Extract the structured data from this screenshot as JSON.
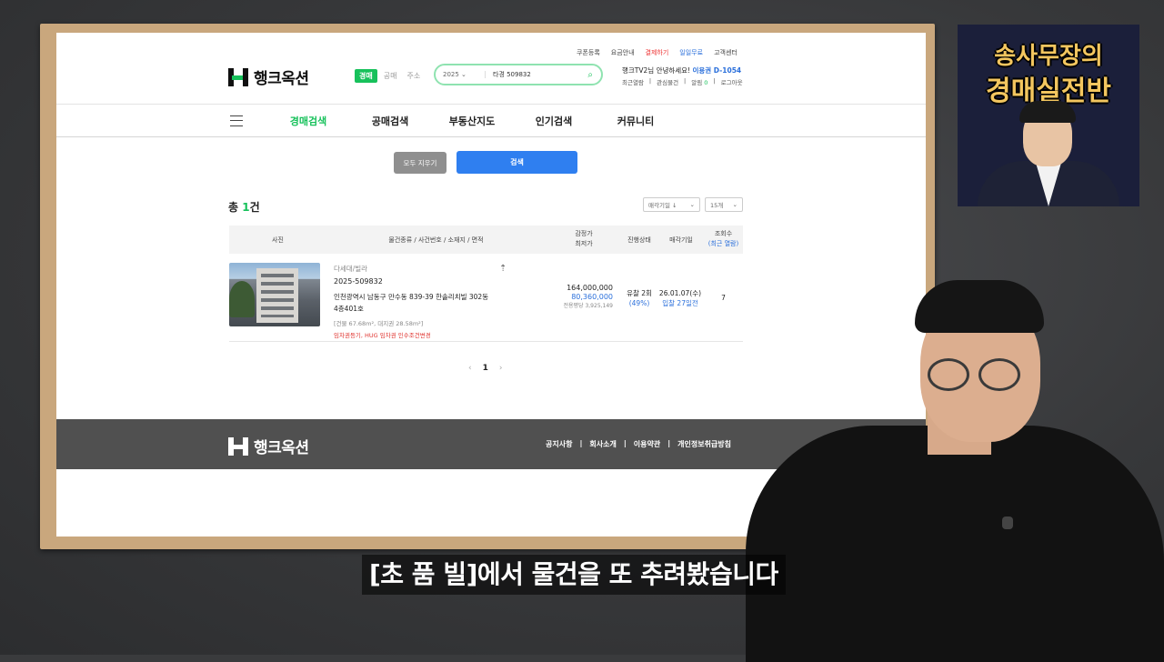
{
  "site": {
    "brand": "행크옥션",
    "top_links": [
      "쿠폰등록",
      "요금안내",
      "결제하기",
      "일일무료",
      "고객센터"
    ],
    "search_tabs": [
      "경매",
      "공매",
      "주소"
    ],
    "search_year": "2025",
    "search_query": "타경 509832",
    "greeting": "행크TV2님 안녕하세요!",
    "plan": "이용권 D-1054",
    "user_links": [
      "최근열람",
      "관심물건",
      "알림",
      "0",
      "로그아웃"
    ],
    "main_menu": [
      "경매검색",
      "공매검색",
      "부동산지도",
      "인기검색",
      "커뮤니티"
    ],
    "clear_button": "모두 지우기",
    "search_button": "검색",
    "total_prefix": "총 ",
    "total_count": "1",
    "total_suffix": "건",
    "sort_select": "매각기일 ↓",
    "page_size_select": "15개",
    "table_headers": {
      "photo": "사진",
      "info": "물건종류 / 사건번호 / 소재지 / 면적",
      "price_1": "감정가",
      "price_2": "최저가",
      "status": "진행상태",
      "date": "매각기일",
      "views_1": "조회수",
      "views_2": "(최근 열람)"
    },
    "listing": {
      "type": "다세대/빌라",
      "case_no": "2025-509832",
      "address_1": "인천광역시 남동구 만수동 839-39 한솔리치빌 302동",
      "address_2": "4층401호",
      "area": "[건물 67.68m², 대지권 28.58m²]",
      "tags": "임차권등기, HUG 임차권 인수조건변경",
      "appraisal": "164,000,000",
      "minimum": "80,360,000",
      "pyeong": "전용평당 3,925,149",
      "status_1": "유찰 2회",
      "status_2": "(49%)",
      "date_1": "26.01.07(수)",
      "date_2": "입찰 27일전",
      "views": "7"
    },
    "pagination": {
      "prev": "‹",
      "current": "1",
      "next": "›"
    },
    "footer_links": [
      "공지사항",
      "|",
      "회사소개",
      "|",
      "이용약관",
      "|",
      "개인정보취급방침"
    ]
  },
  "thumbnail": {
    "line1": "송사무장의",
    "line2": "경매실전반"
  },
  "subtitle": "[초 품 빌]에서 물건을 또 추려봤습니다",
  "colors": {
    "brand_green": "#17c15b",
    "accent_blue": "#2f7ff0",
    "frame_wood": "#c9a77d",
    "thumb_gold": "#f3c65f"
  }
}
